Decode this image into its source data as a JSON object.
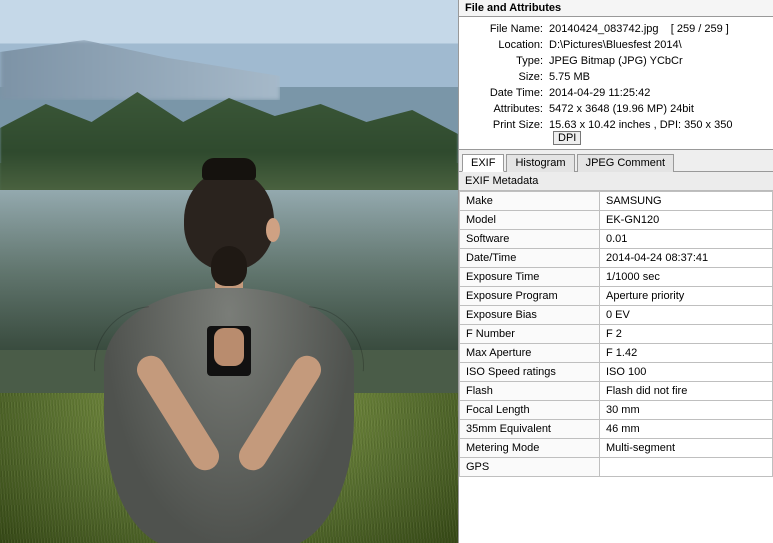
{
  "section_title": "File and Attributes",
  "attrs": {
    "file_name_label": "File Name:",
    "file_name": "20140424_083742.jpg",
    "file_index": "[ 259 / 259 ]",
    "location_label": "Location:",
    "location": "D:\\Pictures\\Bluesfest 2014\\",
    "type_label": "Type:",
    "type": "JPEG Bitmap (JPG) YCbCr",
    "size_label": "Size:",
    "size": "5.75 MB",
    "datetime_label": "Date Time:",
    "datetime": "2014-04-29 11:25:42",
    "attributes_label": "Attributes:",
    "attributes": "5472 x 3648 (19.96 MP)  24bit",
    "printsize_label": "Print Size:",
    "printsize": "15.63 x 10.42 inches ,   DPI: 350 x 350",
    "dpi_button": "DPI"
  },
  "tabs": {
    "exif": "EXIF",
    "histogram": "Histogram",
    "jpeg_comment": "JPEG Comment"
  },
  "metadata_title": "EXIF Metadata",
  "exif": [
    {
      "k": "Make",
      "v": "SAMSUNG"
    },
    {
      "k": "Model",
      "v": "EK-GN120"
    },
    {
      "k": "Software",
      "v": "0.01"
    },
    {
      "k": "Date/Time",
      "v": "2014-04-24 08:37:41"
    },
    {
      "k": "Exposure Time",
      "v": "1/1000 sec"
    },
    {
      "k": "Exposure Program",
      "v": "Aperture priority"
    },
    {
      "k": "Exposure Bias",
      "v": "0 EV"
    },
    {
      "k": "F Number",
      "v": "F 2"
    },
    {
      "k": "Max Aperture",
      "v": "F 1.42"
    },
    {
      "k": "ISO Speed ratings",
      "v": "ISO 100"
    },
    {
      "k": "Flash",
      "v": "Flash did not fire"
    },
    {
      "k": "Focal Length",
      "v": "30 mm"
    },
    {
      "k": "35mm Equivalent",
      "v": "46 mm"
    },
    {
      "k": "Metering Mode",
      "v": "Multi-segment"
    },
    {
      "k": "GPS",
      "v": ""
    }
  ]
}
